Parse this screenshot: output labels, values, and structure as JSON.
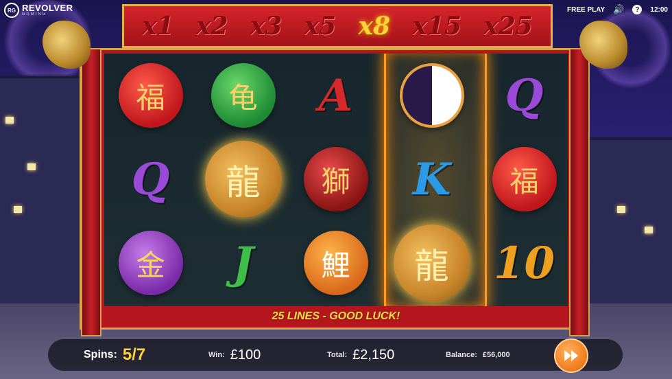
{
  "header": {
    "logo_badge": "RG",
    "logo_text": "REVOLVER",
    "logo_sub": "GAMING",
    "mode_label": "FREE PLAY",
    "help_icon": "?",
    "clock": "12:00"
  },
  "multipliers": [
    {
      "label": "x1",
      "active": false
    },
    {
      "label": "x2",
      "active": false
    },
    {
      "label": "x3",
      "active": false
    },
    {
      "label": "x5",
      "active": false
    },
    {
      "label": "x8",
      "active": true
    },
    {
      "label": "x15",
      "active": false
    },
    {
      "label": "x25",
      "active": false
    }
  ],
  "reels": [
    [
      "lantern-icon",
      "Q",
      "money-bag-icon"
    ],
    [
      "turtle-icon",
      "dragon-coin-icon",
      "J"
    ],
    [
      "A",
      "dragon-mask-icon",
      "koi-fish-icon"
    ],
    [
      "yin-yang-icon",
      "K",
      "dragon-coin-icon"
    ],
    [
      "Q",
      "lantern-icon",
      "10"
    ]
  ],
  "symbol_colors": {
    "Q": "#9b4ad8",
    "A": "#d62a2a",
    "J": "#3fbf4a",
    "K": "#2b9be8",
    "10": "#f0a020"
  },
  "message": "25 LINES - GOOD LUCK!",
  "bottom": {
    "spins_label": "Spins:",
    "spins_value": "5/7",
    "win_label": "Win:",
    "win_value": "£100",
    "total_label": "Total:",
    "total_value": "£2,150",
    "balance_label": "Balance:",
    "balance_value": "£56,000"
  },
  "colors": {
    "accent": "#ffd23a",
    "frame_red": "#b5161e",
    "gold": "#d8a44a",
    "button_orange": "#f07b1a"
  }
}
